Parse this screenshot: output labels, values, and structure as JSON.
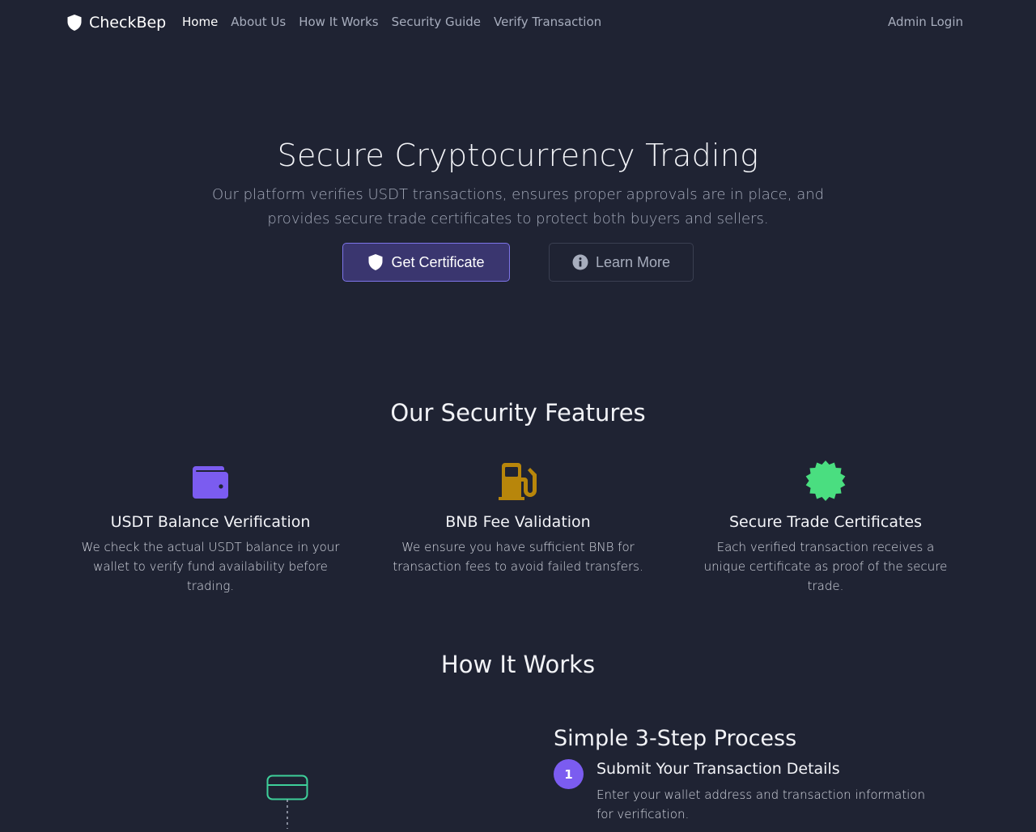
{
  "brand": {
    "name": "CheckBep",
    "icon": "shield-icon"
  },
  "nav": {
    "items": [
      {
        "label": "Home",
        "active": true
      },
      {
        "label": "About Us"
      },
      {
        "label": "How It Works"
      },
      {
        "label": "Security Guide"
      },
      {
        "label": "Verify Transaction"
      }
    ],
    "admin_label": "Admin Login"
  },
  "hero": {
    "title": "Secure Cryptocurrency Trading",
    "subtitle": "Our platform verifies USDT transactions, ensures proper approvals are in place, and provides secure trade certificates to protect both buyers and sellers.",
    "primary_button": {
      "label": "Get Certificate",
      "icon": "shield-icon"
    },
    "secondary_button": {
      "label": "Learn More",
      "icon": "info-circle-icon"
    }
  },
  "features": {
    "title": "Our Security Features",
    "items": [
      {
        "icon": "wallet-icon",
        "color": "#7b5cf0",
        "title": "USDT Balance Verification",
        "description": "We check the actual USDT balance in your wallet to verify fund availability before trading."
      },
      {
        "icon": "gas-pump-icon",
        "color": "#b8860b",
        "title": "BNB Fee Validation",
        "description": "We ensure you have sufficient BNB for transaction fees to avoid failed transfers."
      },
      {
        "icon": "certificate-badge-icon",
        "color": "#4ade80",
        "title": "Secure Trade Certificates",
        "description": "Each verified transaction receives a unique certificate as proof of the secure trade."
      }
    ]
  },
  "how_it_works": {
    "title": "How It Works",
    "process_title": "Simple 3-Step Process",
    "steps": [
      {
        "number": "1",
        "title": "Submit Your Transaction Details",
        "description": "Enter your wallet address and transaction information for verification."
      }
    ]
  },
  "colors": {
    "background": "#1f2333",
    "accent": "#7b5cf0",
    "illustration": "#3ecf9a"
  }
}
